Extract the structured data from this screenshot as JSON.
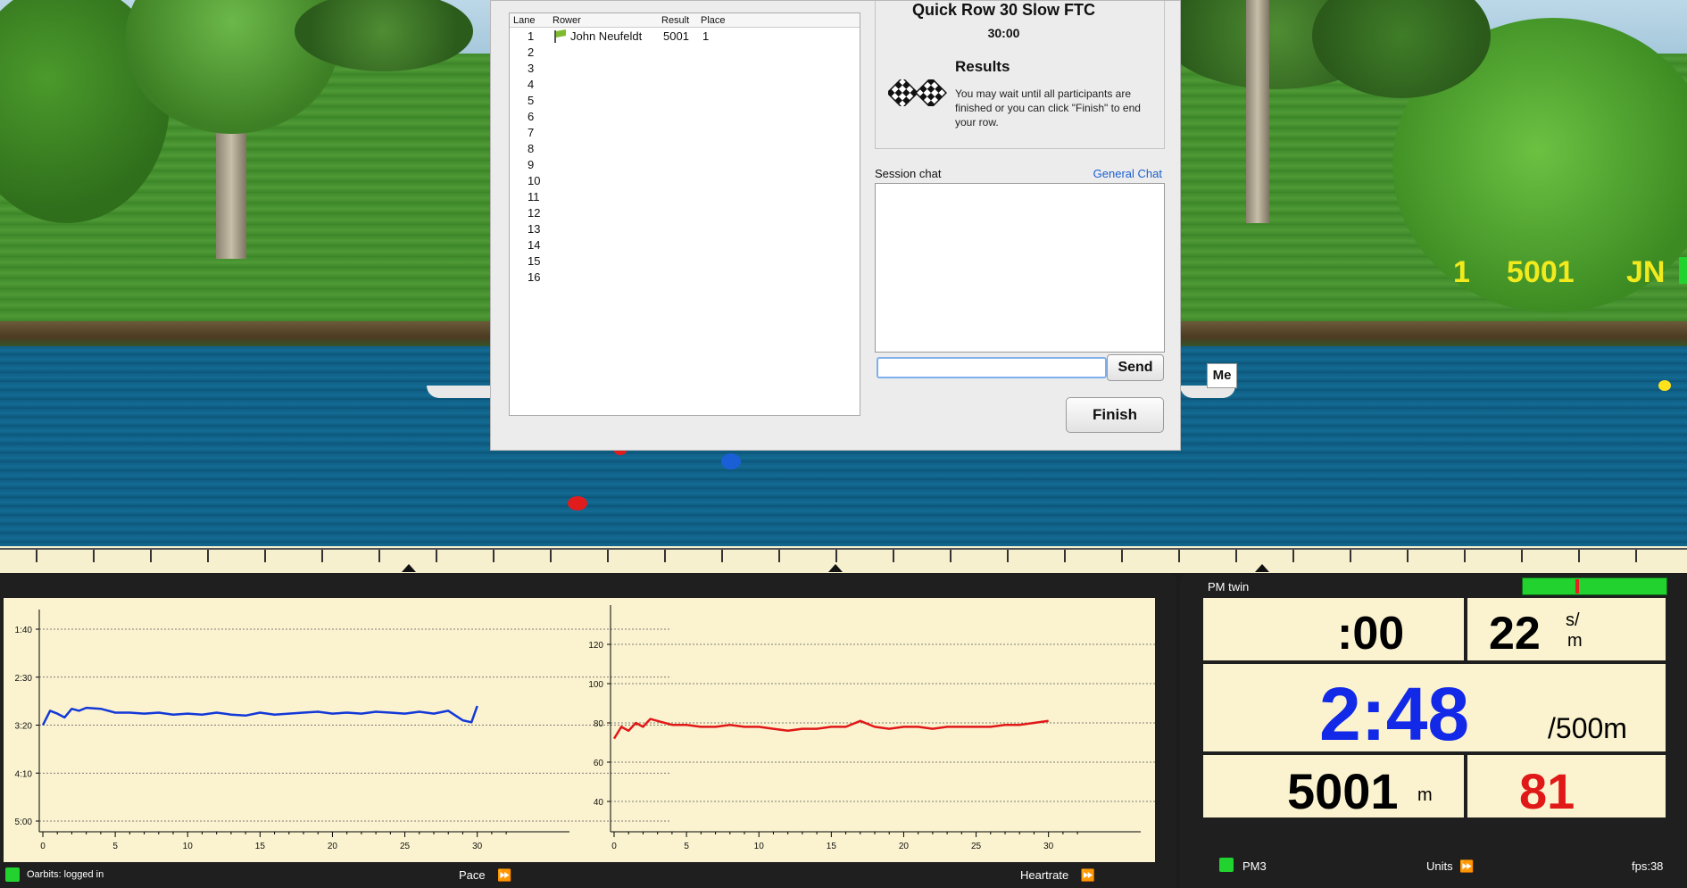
{
  "dialog": {
    "table": {
      "headers": {
        "lane": "Lane",
        "rower": "Rower",
        "result": "Result",
        "place": "Place"
      },
      "rows": [
        {
          "lane": "1",
          "rower": "John Neufeldt",
          "result": "5001",
          "place": "1"
        },
        {
          "lane": "2",
          "rower": "",
          "result": "",
          "place": ""
        },
        {
          "lane": "3",
          "rower": "",
          "result": "",
          "place": ""
        },
        {
          "lane": "4",
          "rower": "",
          "result": "",
          "place": ""
        },
        {
          "lane": "5",
          "rower": "",
          "result": "",
          "place": ""
        },
        {
          "lane": "6",
          "rower": "",
          "result": "",
          "place": ""
        },
        {
          "lane": "7",
          "rower": "",
          "result": "",
          "place": ""
        },
        {
          "lane": "8",
          "rower": "",
          "result": "",
          "place": ""
        },
        {
          "lane": "9",
          "rower": "",
          "result": "",
          "place": ""
        },
        {
          "lane": "10",
          "rower": "",
          "result": "",
          "place": ""
        },
        {
          "lane": "11",
          "rower": "",
          "result": "",
          "place": ""
        },
        {
          "lane": "12",
          "rower": "",
          "result": "",
          "place": ""
        },
        {
          "lane": "13",
          "rower": "",
          "result": "",
          "place": ""
        },
        {
          "lane": "14",
          "rower": "",
          "result": "",
          "place": ""
        },
        {
          "lane": "15",
          "rower": "",
          "result": "",
          "place": ""
        },
        {
          "lane": "16",
          "rower": "",
          "result": "",
          "place": ""
        }
      ]
    },
    "race_title": "Quick Row 30 Slow FTC",
    "race_time": "30:00",
    "results_heading": "Results",
    "results_text": "You may wait until all participants are finished or you can click \"Finish\" to end your row.",
    "chat_label": "Session chat",
    "general_chat_link": "General Chat",
    "chat_input_value": "",
    "send_label": "Send",
    "finish_label": "Finish"
  },
  "scene": {
    "scoreboard": {
      "place": "1",
      "distance": "5001",
      "initials": "JN"
    },
    "me_label": "Me"
  },
  "graphs": {
    "bottom_bar": {
      "status": "Oarbits: logged in",
      "pace_label": "Pace",
      "heartrate_label": "Heartrate"
    }
  },
  "chart_data": [
    {
      "type": "line",
      "title": "",
      "xlabel": "",
      "ylabel": "",
      "x_ticks": [
        "0",
        "5",
        "10",
        "15",
        "20",
        "25",
        "30"
      ],
      "y_ticks": [
        "1:40",
        "2:30",
        "3:20",
        "4:10",
        "5:00"
      ],
      "xlim": [
        0,
        36
      ],
      "ylim_seconds": [
        100,
        300
      ],
      "series": [
        {
          "color": "#1238d8",
          "x": [
            0,
            0.5,
            1,
            1.5,
            2,
            2.5,
            3,
            4,
            5,
            6,
            7,
            8,
            9,
            10,
            11,
            12,
            13,
            14,
            15,
            16,
            17,
            18,
            19,
            20,
            21,
            22,
            23,
            24,
            25,
            26,
            27,
            28,
            29,
            29.6,
            30
          ],
          "y": [
            200,
            185,
            188,
            192,
            183,
            185,
            182,
            183,
            187,
            187,
            188,
            187,
            189,
            188,
            189,
            187,
            189,
            190,
            187,
            189,
            188,
            187,
            186,
            188,
            187,
            188,
            186,
            187,
            188,
            186,
            188,
            185,
            195,
            197,
            180
          ]
        }
      ]
    },
    {
      "type": "line",
      "title": "",
      "xlabel": "",
      "ylabel": "",
      "x_ticks": [
        "0",
        "5",
        "10",
        "15",
        "20",
        "25",
        "30"
      ],
      "y_ticks": [
        "40",
        "60",
        "80",
        "100",
        "120"
      ],
      "xlim": [
        0,
        36
      ],
      "ylim": [
        30,
        130
      ],
      "series": [
        {
          "color": "#e01818",
          "x": [
            0,
            0.5,
            1,
            1.5,
            2,
            2.5,
            3,
            4,
            5,
            6,
            7,
            8,
            9,
            10,
            11,
            12,
            13,
            14,
            15,
            16,
            17,
            18,
            19,
            20,
            21,
            22,
            23,
            24,
            25,
            26,
            27,
            28,
            29,
            30
          ],
          "y": [
            72,
            78,
            76,
            80,
            78,
            82,
            81,
            79,
            79,
            78,
            78,
            79,
            78,
            78,
            77,
            76,
            77,
            77,
            78,
            78,
            81,
            78,
            77,
            78,
            78,
            77,
            78,
            78,
            78,
            78,
            79,
            79,
            80,
            81
          ]
        }
      ]
    }
  ],
  "pm": {
    "title": "PM twin",
    "time": ":00",
    "stroke_rate": "22",
    "stroke_unit_top": "s/",
    "stroke_unit_bottom": "m",
    "pace": "2:48",
    "pace_unit": "/500m",
    "distance": "5001",
    "distance_unit": "m",
    "heart_rate": "81",
    "bottom": {
      "device": "PM3",
      "units_label": "Units",
      "fps": "fps:38"
    },
    "colors": {
      "pace": "#1229e8",
      "heart_rate": "#e01818",
      "meter_green": "#22d32f"
    }
  }
}
